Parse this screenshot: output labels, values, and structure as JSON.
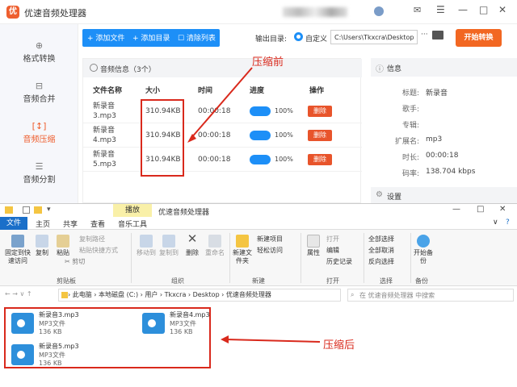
{
  "app": {
    "title": "优速音频处理器",
    "logo_glyph": "优",
    "sidebar": [
      {
        "icon": "format-icon",
        "glyph": "⊕",
        "label": "格式转换"
      },
      {
        "icon": "merge-icon",
        "glyph": "⊟",
        "label": "音频合并"
      },
      {
        "icon": "compress-icon",
        "glyph": "[↕]",
        "label": "音频压缩",
        "active": true
      },
      {
        "icon": "split-icon",
        "glyph": "☰",
        "label": "音频分割"
      }
    ],
    "toolbar": {
      "add_file": "+ 添加文件",
      "add_dir": "+ 添加目录",
      "clear_list": "☐ 清除列表",
      "output_label": "输出目录:",
      "radio_label": "自定义",
      "path_value": "C:\\Users\\Tkxcra\\Desktop",
      "path_more": "···",
      "start": "开始转换"
    },
    "audio_info": {
      "title": "音频信息（3个）",
      "columns": [
        "文件名称",
        "大小",
        "时间",
        "进度",
        "操作"
      ],
      "rows": [
        {
          "name": "新录音3.mp3",
          "size": "310.94KB",
          "duration": "00:00:18",
          "progress": "100%",
          "action": "删除"
        },
        {
          "name": "新录音4.mp3",
          "size": "310.94KB",
          "duration": "00:00:18",
          "progress": "100%",
          "action": "删除"
        },
        {
          "name": "新录音5.mp3",
          "size": "310.94KB",
          "duration": "00:00:18",
          "progress": "100%",
          "action": "删除"
        }
      ]
    },
    "info": {
      "title": "信息",
      "fields": [
        {
          "k": "标题:",
          "v": "新录音"
        },
        {
          "k": "歌手:",
          "v": ""
        },
        {
          "k": "专辑:",
          "v": ""
        },
        {
          "k": "扩展名:",
          "v": "mp3"
        },
        {
          "k": "时长:",
          "v": "00:00:18"
        },
        {
          "k": "码率:",
          "v": "138.704 kbps"
        }
      ],
      "settings": "设置"
    },
    "annotation": "压缩前"
  },
  "explorer": {
    "play_tab": "播放",
    "title": "优速音频处理器",
    "tabs": [
      "主页",
      "共享",
      "查看",
      "音乐工具"
    ],
    "file_tab": "文件",
    "ribbon": {
      "pin": "固定到快速访问",
      "copy": "复制",
      "paste": "粘贴",
      "copy_path": "复制路径",
      "paste_shortcut": "粘贴快捷方式",
      "cut": "✂ 剪切",
      "group_clipboard": "剪贴板",
      "move_to": "移动到",
      "copy_to": "复制到",
      "delete": "删除",
      "rename": "重命名",
      "group_organize": "组织",
      "new_folder": "新建文件夹",
      "new_item": "新建项目",
      "easy_access": "轻松访问",
      "group_new": "新建",
      "properties": "属性",
      "open": "打开",
      "edit": "编辑",
      "history": "历史记录",
      "group_open": "打开",
      "select_all": "全部选择",
      "select_none": "全部取消",
      "invert": "反向选择",
      "group_select": "选择",
      "backup": "开始备份",
      "group_backup": "备份"
    },
    "address": "› 此电脑 › 本地磁盘 (C:) › 用户 › Tkxcra › Desktop › 优速音频处理器",
    "search_placeholder": "在 优速音频处理器 中搜索",
    "nav": "← → ∨ ↑",
    "files": [
      {
        "name": "新录音3.mp3",
        "type": "MP3文件",
        "size": "136 KB"
      },
      {
        "name": "新录音4.mp3",
        "type": "MP3文件",
        "size": "136 KB"
      },
      {
        "name": "新录音5.mp3",
        "type": "MP3文件",
        "size": "136 KB"
      }
    ],
    "annotation": "压缩后"
  },
  "colors": {
    "accent": "#1d8ff7",
    "start": "#f26722",
    "annotation": "#d9291c"
  }
}
